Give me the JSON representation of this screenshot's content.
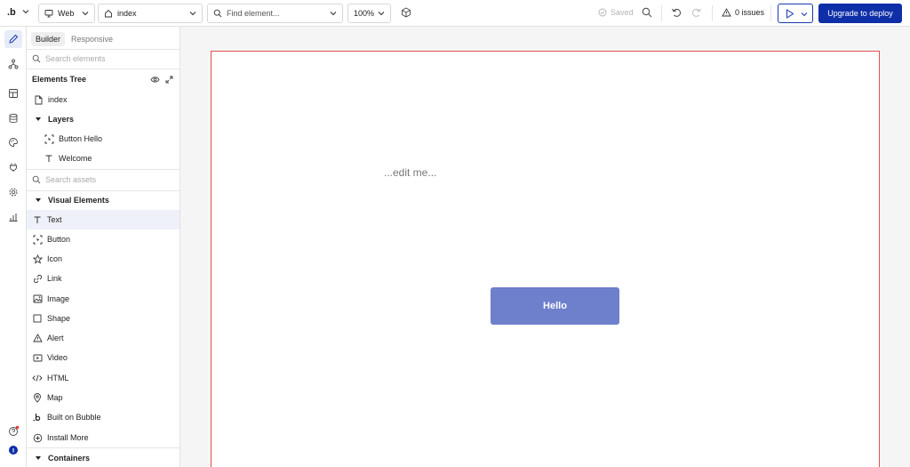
{
  "topbar": {
    "logo": ".b",
    "platform": "Web",
    "page": "index",
    "find_placeholder": "Find element...",
    "zoom": "100%",
    "saved": "Saved",
    "issues": "0 issues",
    "deploy": "Upgrade to deploy"
  },
  "panel": {
    "tabs": [
      "Builder",
      "Responsive"
    ],
    "search_elements_placeholder": "Search elements",
    "tree_title": "Elements Tree",
    "tree": [
      "index",
      "Layers",
      "Button Hello",
      "Welcome"
    ],
    "search_assets_placeholder": "Search assets",
    "visual_title": "Visual Elements",
    "visual_items": [
      "Text",
      "Button",
      "Icon",
      "Link",
      "Image",
      "Shape",
      "Alert",
      "Video",
      "HTML",
      "Map",
      "Built on Bubble",
      "Install More"
    ],
    "containers_title": "Containers"
  },
  "canvas": {
    "edit_text": "...edit me...",
    "button_label": "Hello"
  },
  "colors": {
    "accent": "#0e2fa8",
    "button": "#6e7fcc",
    "page_border": "#e45050"
  }
}
